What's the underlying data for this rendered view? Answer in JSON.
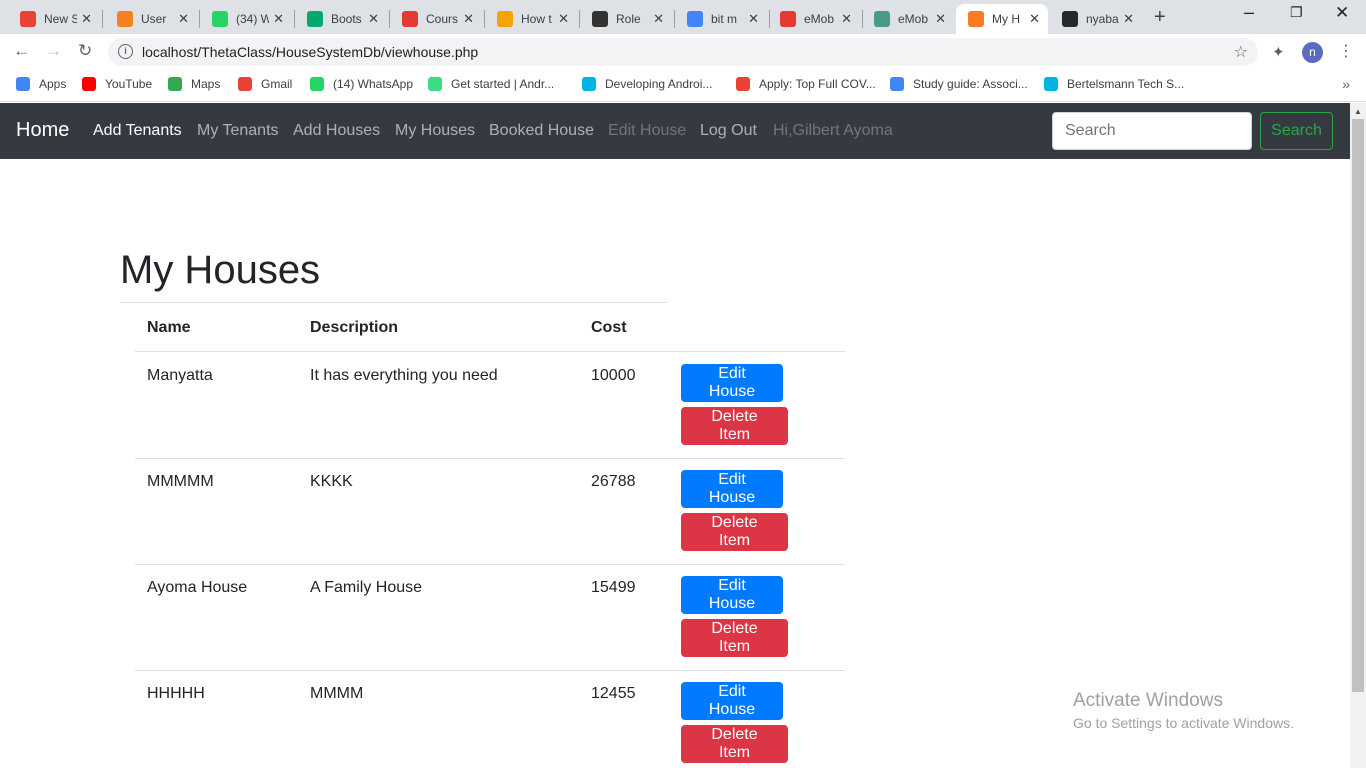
{
  "browser": {
    "tabs": [
      {
        "title": "New S",
        "icon": "gmail-icon",
        "icon_color": "#ea4335"
      },
      {
        "title": "User",
        "icon": "stackoverflow-icon",
        "icon_color": "#f48024"
      },
      {
        "title": "(34) W",
        "icon": "whatsapp-icon",
        "icon_color": "#25d366"
      },
      {
        "title": "Boots",
        "icon": "w3schools-icon",
        "icon_color": "#04aa6d"
      },
      {
        "title": "Cours",
        "icon": "emobilis-icon",
        "icon_color": "#e53935"
      },
      {
        "title": "How t",
        "icon": "howto-icon",
        "icon_color": "#f4a300"
      },
      {
        "title": "Role",
        "icon": "role-icon",
        "icon_color": "#333333"
      },
      {
        "title": "bit m",
        "icon": "google-icon",
        "icon_color": "#4285f4"
      },
      {
        "title": "eMob",
        "icon": "emobilis-icon",
        "icon_color": "#e53935"
      },
      {
        "title": "eMob",
        "icon": "emobilis-globe-icon",
        "icon_color": "#4a9a8c"
      },
      {
        "title": "My H",
        "icon": "xampp-icon",
        "icon_color": "#fb7a24"
      },
      {
        "title": "nyaba",
        "icon": "github-icon",
        "icon_color": "#24292e"
      }
    ],
    "url": "localhost/ThetaClass/HouseSystemDb/viewhouse.php",
    "profile_initial": "n",
    "bookmarks": [
      {
        "label": "Apps",
        "icon": "apps-grid-icon",
        "color": "#4285f4"
      },
      {
        "label": "YouTube",
        "icon": "youtube-icon",
        "color": "#ff0000"
      },
      {
        "label": "Maps",
        "icon": "maps-pin-icon",
        "color": "#34a853"
      },
      {
        "label": "Gmail",
        "icon": "gmail-icon",
        "color": "#ea4335"
      },
      {
        "label": "(14) WhatsApp",
        "icon": "whatsapp-icon",
        "color": "#25d366"
      },
      {
        "label": "Get started | Andr...",
        "icon": "android-icon",
        "color": "#3ddc84"
      },
      {
        "label": "Developing Androi...",
        "icon": "udacity-icon",
        "color": "#02b3e4"
      },
      {
        "label": "Apply: Top Full COV...",
        "icon": "gmail-icon",
        "color": "#ea4335"
      },
      {
        "label": "Study guide: Associ...",
        "icon": "code-icon",
        "color": "#4285f4"
      },
      {
        "label": "Bertelsmann Tech S...",
        "icon": "udacity-icon",
        "color": "#02b3e4"
      }
    ]
  },
  "navbar": {
    "brand": "Home",
    "links": [
      {
        "label": "Add Tenants",
        "state": "active"
      },
      {
        "label": "My Tenants",
        "state": "normal"
      },
      {
        "label": "Add Houses",
        "state": "normal"
      },
      {
        "label": "My Houses",
        "state": "normal"
      },
      {
        "label": "Booked House",
        "state": "normal"
      },
      {
        "label": "Edit House",
        "state": "disabled"
      },
      {
        "label": "Log Out",
        "state": "normal"
      },
      {
        "label": "Hi,Gilbert Ayoma",
        "state": "disabled"
      }
    ],
    "search_placeholder": "Search",
    "search_button": "Search"
  },
  "main": {
    "title": "My Houses",
    "columns": [
      "Name",
      "Description",
      "Cost"
    ],
    "rows": [
      {
        "name": "Manyatta",
        "description": "It has everything you need",
        "cost": "10000"
      },
      {
        "name": "MMMMM",
        "description": "KKKK",
        "cost": "26788"
      },
      {
        "name": "Ayoma House",
        "description": "A Family House",
        "cost": "15499"
      },
      {
        "name": "HHHHH",
        "description": "MMMM",
        "cost": "12455"
      }
    ],
    "edit_label": "Edit House",
    "delete_label": "Delete Item"
  },
  "watermark": {
    "line1": "Activate Windows",
    "line2": "Go to Settings to activate Windows."
  },
  "colors": {
    "navbar_bg": "#343a40",
    "primary": "#007bff",
    "danger": "#dc3545",
    "success": "#28a745"
  }
}
